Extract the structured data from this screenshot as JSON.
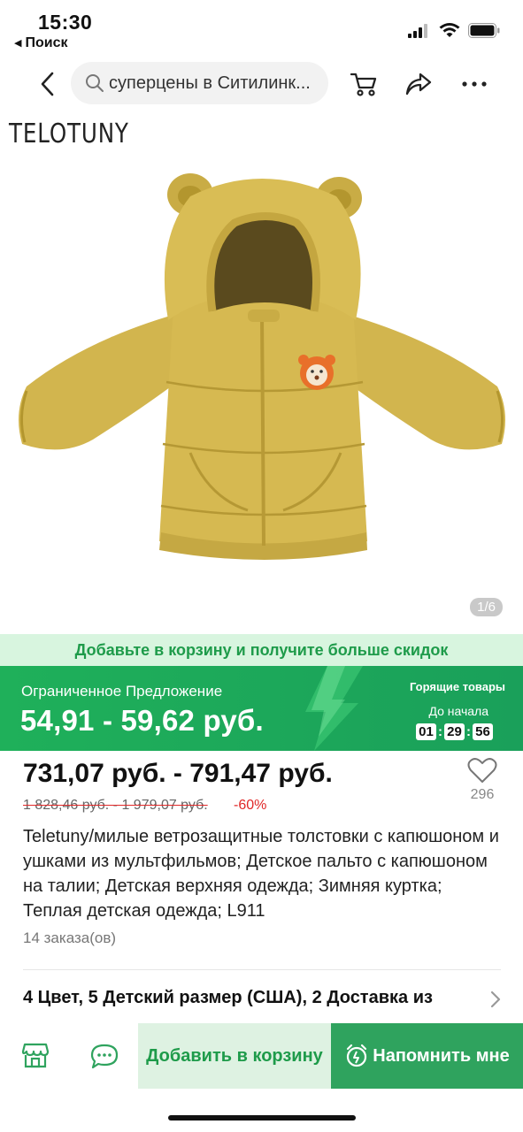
{
  "status_bar": {
    "time": "15:30",
    "back_app": "Поиск"
  },
  "nav": {
    "search_text": "суперцены в Ситилинк..."
  },
  "product_image": {
    "brand": "TELOTUNY",
    "counter": "1/6"
  },
  "promo_strip": {
    "text": "Добавьте в корзину и получите больше скидок"
  },
  "offer": {
    "label": "Ограниченное Предложение",
    "price": "54,91 - 59,62 руб.",
    "hot_label": "Горящие товары",
    "until_label": "До начала",
    "timer": {
      "h": "01",
      "m": "29",
      "s": "56"
    }
  },
  "price": {
    "main": "731,07 руб. - 791,47 руб.",
    "old": "1 828,46 руб. - 1 979,07 руб.",
    "discount": "-60%",
    "favorites_count": "296"
  },
  "product": {
    "title": "Teletuny/милые ветрозащитные толстовки с капюшоном и ушками из мультфильмов; Детское пальто с капюшоном на талии; Детская верхняя одежда; Зимняя куртка; Теплая детская одежда; L911",
    "orders": "14 заказа(ов)",
    "options": "4 Цвет, 5 Детский размер (США), 2 Доставка из"
  },
  "bottom_bar": {
    "add_to_cart": "Добавить в корзину",
    "remind": "Напомнить мне"
  },
  "colors": {
    "accent_green": "#1fb05a",
    "price_red": "#e02828"
  }
}
